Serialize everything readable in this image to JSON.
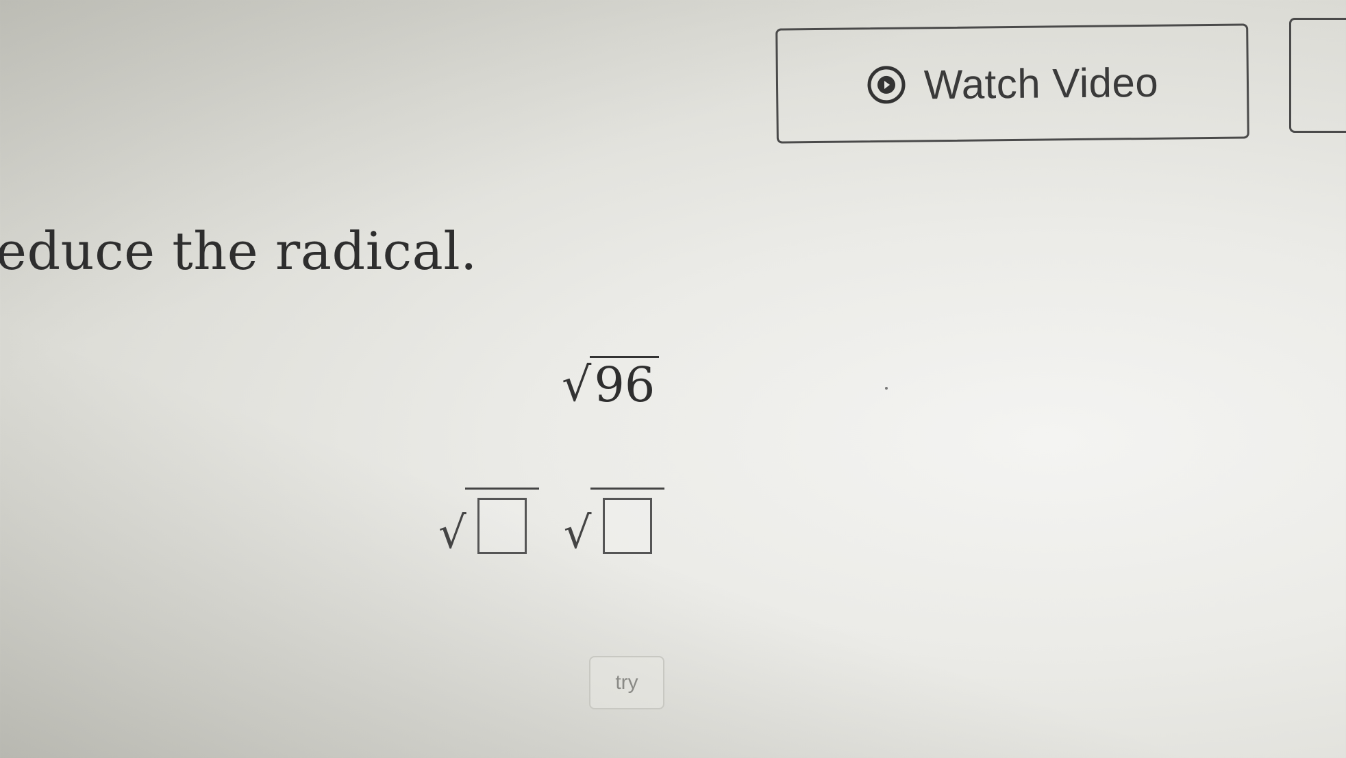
{
  "header": {
    "watch_video_label": "Watch Video"
  },
  "question": {
    "instruction": "educe the radical.",
    "radicand": "96",
    "radical_symbol": "√"
  },
  "answer": {
    "box1_value": "",
    "box2_value": ""
  },
  "actions": {
    "try_label": "try"
  },
  "colors": {
    "text": "#2e2e2e",
    "border": "#4a4a4a"
  },
  "icons": {
    "play": "play-circle-icon"
  }
}
